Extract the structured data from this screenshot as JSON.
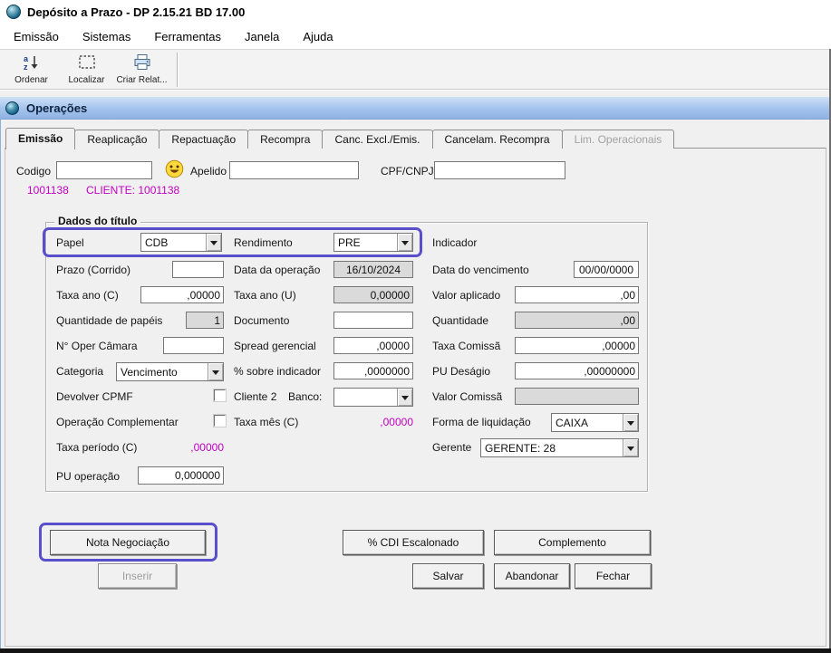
{
  "window": {
    "title": "Depósito a Prazo -  DP 2.15.21 BD 17.00"
  },
  "menu": {
    "items": [
      "Emissão",
      "Sistemas",
      "Ferramentas",
      "Janela",
      "Ajuda"
    ]
  },
  "toolbar": {
    "buttons": [
      {
        "label": "Ordenar",
        "icon": "sort-az-icon"
      },
      {
        "label": "Localizar",
        "icon": "find-selection-icon"
      },
      {
        "label": "Criar Relat...",
        "icon": "printer-report-icon"
      }
    ]
  },
  "mdi": {
    "title": "Operações"
  },
  "tabs": [
    {
      "label": "Emissão",
      "state": "active"
    },
    {
      "label": "Reaplicação",
      "state": "normal"
    },
    {
      "label": "Repactuação",
      "state": "normal"
    },
    {
      "label": "Recompra",
      "state": "normal"
    },
    {
      "label": "Canc. Excl./Emis.",
      "state": "normal"
    },
    {
      "label": "Cancelam. Recompra",
      "state": "normal"
    },
    {
      "label": "Lim. Operacionais",
      "state": "disabled"
    }
  ],
  "header": {
    "codigo": {
      "label": "Codigo",
      "value": ""
    },
    "apelido": {
      "label": "Apelido",
      "value": ""
    },
    "cpf_cnpj": {
      "label": "CPF/CNPJ",
      "value": ""
    },
    "client_code": "1001138",
    "client_name": "CLIENTE: 1001138"
  },
  "dados": {
    "title": "Dados do título",
    "papel": {
      "label": "Papel",
      "value": "CDB"
    },
    "rendimento": {
      "label": "Rendimento",
      "value": "PRE"
    },
    "indicador_label": "Indicador",
    "prazo": {
      "label": "Prazo (Corrido)",
      "value": ""
    },
    "data_operacao": {
      "label": "Data da operação",
      "value": "16/10/2024"
    },
    "data_vencimento": {
      "label": "Data do vencimento",
      "value": "00/00/0000"
    },
    "taxa_ano_c": {
      "label": "Taxa ano (C)",
      "value": ",00000"
    },
    "taxa_ano_u": {
      "label": "Taxa ano (U)",
      "value": "0,00000"
    },
    "valor_aplicado": {
      "label": "Valor aplicado",
      "value": ",00"
    },
    "qtd_papeis": {
      "label": "Quantidade de papéis",
      "value": "1"
    },
    "documento": {
      "label": "Documento",
      "value": ""
    },
    "quantidade": {
      "label": "Quantidade",
      "value": ",00"
    },
    "oper_camara": {
      "label": "N° Oper Câmara",
      "value": ""
    },
    "spread_gerencial": {
      "label": "Spread gerencial",
      "value": ",00000"
    },
    "taxa_comissao": {
      "label": "Taxa Comissã",
      "value": ",00000"
    },
    "categoria": {
      "label": "Categoria",
      "value": "Vencimento"
    },
    "pct_sobre_indicador": {
      "label": "% sobre indicador",
      "value": ",0000000"
    },
    "pu_desagio": {
      "label": "PU Deságio",
      "value": ",00000000"
    },
    "devolver_cpmf": {
      "label": "Devolver CPMF",
      "checked": false
    },
    "cliente2_label": "Cliente 2",
    "banco": {
      "label": "Banco:",
      "value": ""
    },
    "valor_comissao": {
      "label": "Valor Comissã",
      "value": ""
    },
    "op_complementar": {
      "label": "Operação Complementar",
      "checked": false
    },
    "taxa_mes": {
      "label": "Taxa mês (C)",
      "value": ",00000"
    },
    "forma_liquidacao": {
      "label": "Forma de liquidação",
      "value": "CAIXA"
    },
    "taxa_periodo": {
      "label": "Taxa período (C)",
      "value": ",00000"
    },
    "gerente": {
      "label": "Gerente",
      "value": "GERENTE: 28"
    },
    "pu_operacao": {
      "label": "PU operação",
      "value": "0,000000"
    }
  },
  "actions": {
    "nota_negociacao": "Nota Negociação",
    "cdi_escalonado": "% CDI Escalonado",
    "complemento": "Complemento",
    "inserir": "Inserir",
    "salvar": "Salvar",
    "abandonar": "Abandonar",
    "fechar": "Fechar"
  },
  "colors": {
    "annotation_highlight": "#5a4ecb",
    "magenta_text": "#c400c4",
    "mdi_titlebar_top": "#cfe1f7",
    "mdi_titlebar_bottom": "#8fb3e4"
  }
}
